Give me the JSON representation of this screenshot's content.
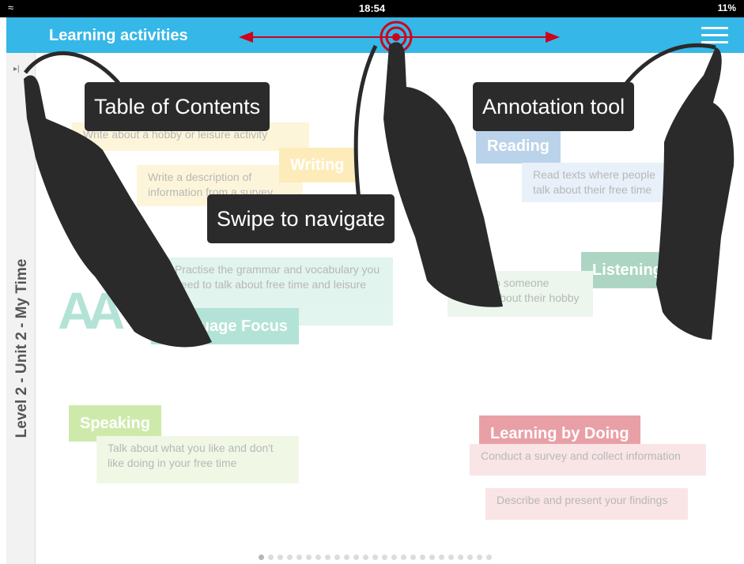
{
  "status_bar": {
    "time": "18:54",
    "battery": "11%"
  },
  "app_bar": {
    "title": "Learning activities"
  },
  "sidebar": {
    "unit_label": "Level 2 - Unit 2 - My Time"
  },
  "activities": {
    "writing": {
      "label": "Writing",
      "items": [
        "Write about a hobby or leisure activity",
        "Write a description of information from a survey"
      ]
    },
    "reading": {
      "label": "Reading",
      "items": [
        "Read texts where people talk about their free time"
      ]
    },
    "language_focus": {
      "label": "Language Focus",
      "items": [
        "Practise the grammar and vocabulary you need to talk about free time and leisure"
      ]
    },
    "listening": {
      "label": "Listening",
      "items": [
        "Listen to someone talking about their hobby"
      ]
    },
    "speaking": {
      "label": "Speaking",
      "items": [
        "Talk about what you like and don't like doing in your free time"
      ]
    },
    "learning_by_doing": {
      "label": "Learning by Doing",
      "items": [
        "Conduct a survey and collect information",
        "Describe and present your findings"
      ]
    }
  },
  "callouts": {
    "toc": "Table of Contents",
    "annotation": "Annotation tool",
    "swipe": "Swipe to navigate"
  },
  "pagination": {
    "total": 25,
    "current": 1
  },
  "colors": {
    "app_bar": "#35b7e8",
    "writing": "#fbd45a",
    "reading": "#5c98cf",
    "language_focus": "#4cbd9f",
    "listening": "#3b9e72",
    "speaking": "#8ccf3a",
    "learning_by_doing": "#c9202e",
    "callout": "#2b2b2b",
    "swipe_arrow": "#d0021b"
  }
}
